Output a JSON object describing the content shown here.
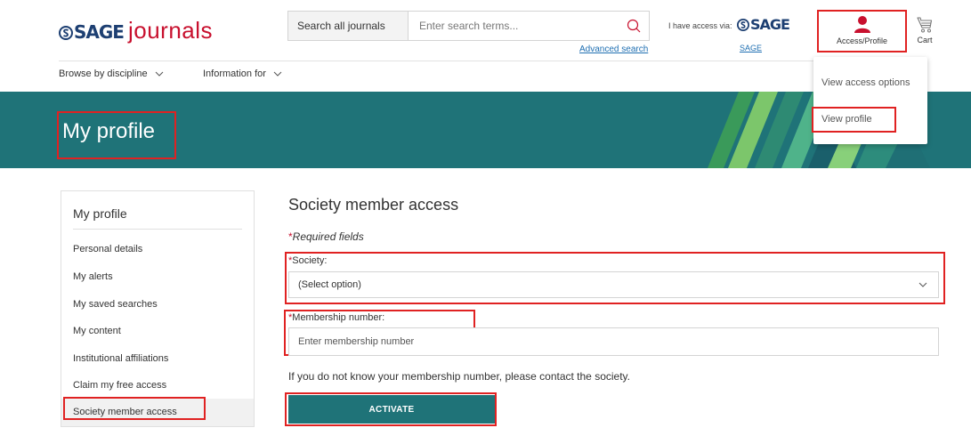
{
  "header": {
    "logo": {
      "brand": "SAGE",
      "product": "journals"
    },
    "search": {
      "scope": "Search all journals",
      "placeholder": "Enter search terms...",
      "advanced": "Advanced search"
    },
    "access": {
      "label": "I have access via:",
      "institution": "SAGE",
      "institution_link": "SAGE"
    },
    "account_label": "Access/Profile",
    "cart_label": "Cart"
  },
  "nav": {
    "items": [
      {
        "label": "Browse by discipline"
      },
      {
        "label": "Information for"
      }
    ]
  },
  "banner": {
    "title": "My profile"
  },
  "dropdown": {
    "items": [
      {
        "label": "View access options"
      },
      {
        "label": "View profile"
      }
    ]
  },
  "sidebar": {
    "title": "My profile",
    "items": [
      {
        "label": "Personal details"
      },
      {
        "label": "My alerts"
      },
      {
        "label": "My saved searches"
      },
      {
        "label": "My content"
      },
      {
        "label": "Institutional affiliations"
      },
      {
        "label": "Claim my free access"
      },
      {
        "label": "Society member access"
      }
    ]
  },
  "form": {
    "title": "Society member access",
    "required_star": "*",
    "required_note": "Required fields",
    "society_label": "Society:",
    "society_value": "(Select option)",
    "membership_label": "Membership number:",
    "membership_placeholder": "Enter membership number",
    "help_text": "If you do not know your membership number, please contact the society.",
    "activate_label": "ACTIVATE"
  },
  "colors": {
    "teal": "#1f7378",
    "sage_blue": "#1d3f72",
    "sage_red": "#c8102e",
    "highlight_red": "#e02222",
    "link_blue": "#1f6fb2"
  }
}
